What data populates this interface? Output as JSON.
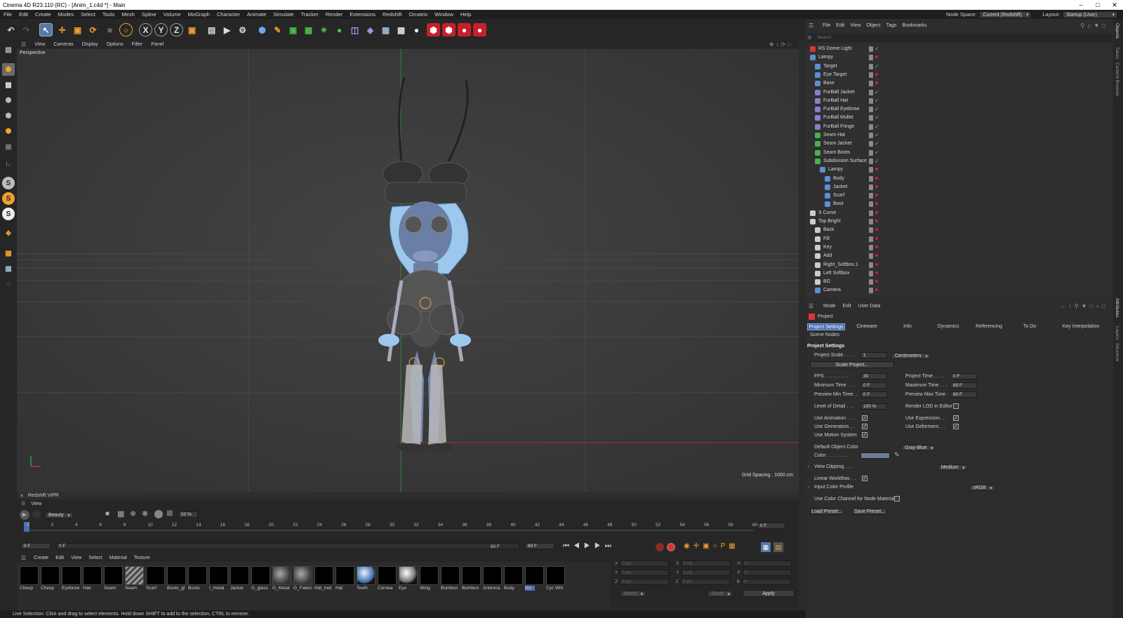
{
  "window": {
    "title": "Cinema 4D R23.110 (RC) - [Anim_1.c4d *] - Main"
  },
  "menubar": {
    "items": [
      "File",
      "Edit",
      "Create",
      "Modes",
      "Select",
      "Tools",
      "Mesh",
      "Spline",
      "Volume",
      "MoGraph",
      "Character",
      "Animate",
      "Simulate",
      "Tracker",
      "Render",
      "Extensions",
      "Redshift",
      "Ornatrix",
      "Window",
      "Help"
    ],
    "node_space_label": "Node Space:",
    "node_space_value": "Current (Redshift)",
    "layout_label": "Layout:",
    "layout_value": "Startup (User)"
  },
  "viewport": {
    "menu": [
      "View",
      "Cameras",
      "Display",
      "Options",
      "Filter",
      "Panel"
    ],
    "camera_label": "Perspective",
    "grid_spacing": "Grid Spacing : 1000 cm"
  },
  "vipr": {
    "title": "Redshift VIPR",
    "view_label": "View",
    "pass_value": "Beauty",
    "zoom_value": "50 %"
  },
  "timeline": {
    "ticks": [
      "0",
      "2",
      "4",
      "6",
      "8",
      "10",
      "12",
      "14",
      "16",
      "18",
      "20",
      "22",
      "24",
      "26",
      "28",
      "30",
      "32",
      "34",
      "36",
      "38",
      "40",
      "42",
      "44",
      "46",
      "48",
      "50",
      "52",
      "54",
      "56",
      "58",
      "60"
    ],
    "current_frame_right": "0 F",
    "start_field": "0 F",
    "start_field2": "0 F",
    "end_field": "60 F",
    "end_field2": "60 F"
  },
  "materials": {
    "menu": [
      "Create",
      "Edit",
      "View",
      "Select",
      "Material",
      "Texture"
    ],
    "items": [
      {
        "label": "Cheep",
        "swatch": "#000000"
      },
      {
        "label": "Cheep",
        "swatch": "#000000"
      },
      {
        "label": "Eyebrow",
        "swatch": "#000000"
      },
      {
        "label": "Hair",
        "swatch": "#000000"
      },
      {
        "label": "Seam",
        "swatch": "#000000"
      },
      {
        "label": "Seam",
        "swatch": "stripes"
      },
      {
        "label": "Scarf",
        "swatch": "#000000"
      },
      {
        "label": "Boots_gl",
        "swatch": "#000000"
      },
      {
        "label": "Boots",
        "swatch": "#000000"
      },
      {
        "label": "I_metal",
        "swatch": "#000000"
      },
      {
        "label": "Jacket",
        "swatch": "#000000"
      },
      {
        "label": "G_glass",
        "swatch": "#000000"
      },
      {
        "label": "G_Metal",
        "swatch": "rs"
      },
      {
        "label": "G_Fabric",
        "swatch": "rs"
      },
      {
        "label": "Hat_met",
        "swatch": "#000000"
      },
      {
        "label": "Hat",
        "swatch": "#000000"
      },
      {
        "label": "Teeth",
        "swatch": "sphere"
      },
      {
        "label": "Cornea",
        "swatch": "#000000"
      },
      {
        "label": "Eye",
        "swatch": "sphere2"
      },
      {
        "label": "Wing",
        "swatch": "#000000"
      },
      {
        "label": "Bumbun",
        "swatch": "#000000"
      },
      {
        "label": "Bumbun",
        "swatch": "#000000"
      },
      {
        "label": "Antenna",
        "swatch": "#000000"
      },
      {
        "label": "Body",
        "swatch": "#000000"
      },
      {
        "label": "BG",
        "swatch": "#000000"
      },
      {
        "label": "Cyc Whi",
        "swatch": "#000000"
      }
    ]
  },
  "coords": {
    "rows": [
      {
        "a": "X",
        "av": "0 cm",
        "b": "X",
        "bv": "0 cm",
        "c": "H",
        "cv": "0 °"
      },
      {
        "a": "Y",
        "av": "0 cm",
        "b": "Y",
        "bv": "0 cm",
        "c": "P",
        "cv": "0 °"
      },
      {
        "a": "Z",
        "av": "0 cm",
        "b": "Z",
        "bv": "0 cm",
        "c": "B",
        "cv": "0 °"
      }
    ],
    "space_value": "World",
    "mode_value": "Scale",
    "apply_label": "Apply"
  },
  "status": "Live Selection: Click and drag to select elements. Hold down SHIFT to add to the selection, CTRL to remove.",
  "objects": {
    "menu": [
      "File",
      "Edit",
      "View",
      "Object",
      "Tags",
      "Bookmarks"
    ],
    "search_placeholder": "Search",
    "rows": [
      {
        "name": "RS Dome Light",
        "indent": 0,
        "icon": "#d33",
        "check": true
      },
      {
        "name": "Lampy",
        "indent": 0,
        "icon": "#5b8fd6",
        "check": false
      },
      {
        "name": "Target",
        "indent": 1,
        "icon": "#5b8fd6",
        "check": true
      },
      {
        "name": "Eye Target",
        "indent": 1,
        "icon": "#5b8fd6",
        "check": false
      },
      {
        "name": "Base",
        "indent": 1,
        "icon": "#5b8fd6",
        "check": false
      },
      {
        "name": "FurBall Jacket",
        "indent": 1,
        "icon": "#8a7fc8",
        "check": true
      },
      {
        "name": "FurBall Hat",
        "indent": 1,
        "icon": "#8a7fc8",
        "check": true
      },
      {
        "name": "FurBall Eyebrow",
        "indent": 1,
        "icon": "#8a7fc8",
        "check": true
      },
      {
        "name": "FurBall Mullet",
        "indent": 1,
        "icon": "#8a7fc8",
        "check": true
      },
      {
        "name": "FurBall Fringe",
        "indent": 1,
        "icon": "#8a7fc8",
        "check": true
      },
      {
        "name": "Seam Hat",
        "indent": 1,
        "icon": "#4caf50",
        "check": true
      },
      {
        "name": "Seam Jacket",
        "indent": 1,
        "icon": "#4caf50",
        "check": true
      },
      {
        "name": "Seam Boots",
        "indent": 1,
        "icon": "#4caf50",
        "check": true
      },
      {
        "name": "Subdivision Surface",
        "indent": 1,
        "icon": "#4caf50",
        "check": true
      },
      {
        "name": "Lampy",
        "indent": 2,
        "icon": "#5b8fd6",
        "check": false
      },
      {
        "name": "Body",
        "indent": 3,
        "icon": "#5b8fd6",
        "check": false
      },
      {
        "name": "Jacket",
        "indent": 3,
        "icon": "#5b8fd6",
        "check": false
      },
      {
        "name": "Scarf",
        "indent": 3,
        "icon": "#5b8fd6",
        "check": false
      },
      {
        "name": "Boot",
        "indent": 3,
        "icon": "#5b8fd6",
        "check": false
      },
      {
        "name": "S Curve",
        "indent": 0,
        "icon": "#cccccc",
        "check": false
      },
      {
        "name": "Top Bright",
        "indent": 0,
        "icon": "#cccccc",
        "check": false
      },
      {
        "name": "Back",
        "indent": 1,
        "icon": "#cccccc",
        "check": false
      },
      {
        "name": "Fill",
        "indent": 1,
        "icon": "#cccccc",
        "check": false
      },
      {
        "name": "Key",
        "indent": 1,
        "icon": "#cccccc",
        "check": false
      },
      {
        "name": "Add",
        "indent": 1,
        "icon": "#cccccc",
        "check": false
      },
      {
        "name": "Right_Softbox.1",
        "indent": 1,
        "icon": "#cccccc",
        "check": false
      },
      {
        "name": "Left Softbox",
        "indent": 1,
        "icon": "#cccccc",
        "check": false
      },
      {
        "name": "BG",
        "indent": 1,
        "icon": "#cccccc",
        "check": false
      },
      {
        "name": "Camera",
        "indent": 1,
        "icon": "#5b8fd6",
        "check": false
      }
    ]
  },
  "attributes": {
    "menu": [
      "Mode",
      "Edit",
      "User Data"
    ],
    "object_name": "Project",
    "tabs": [
      "Project Settings",
      "Cineware",
      "Info",
      "Dynamics",
      "Referencing",
      "To Do",
      "Key Interpolation",
      "Scene Nodes"
    ],
    "section_title": "Project Settings",
    "project_scale_label": "Project Scale . . . .",
    "project_scale_value": "1",
    "project_scale_unit": "Centimeters",
    "scale_project_button": "Scale Project...",
    "fps_label": "FPS . . . . . . . . .",
    "fps_value": "30",
    "project_time_label": "Project Time . . . .",
    "project_time_value": "0 F",
    "min_time_label": "Minimum Time . . .",
    "min_time_value": "0 F",
    "max_time_label": "Maximum Time . . .",
    "max_time_value": "60 F",
    "prev_min_label": "Preview Min Time. .",
    "prev_min_value": "0 F",
    "prev_max_label": "Preview Max Time .",
    "prev_max_value": "60 F",
    "lod_label": "Level of Detail . . .",
    "lod_value": "100 %",
    "render_lod_label": "Render LOD in Editor",
    "use_animation_label": "Use Animation . . .",
    "use_expression_label": "Use Expression. . .",
    "use_generators_label": "Use Generators . .",
    "use_deformers_label": "Use Deformers. . .",
    "use_motion_label": "Use Motion System",
    "default_color_label": "Default Object Color",
    "default_color_value": "Gray-Blue",
    "color_label": "Color . . . . . . . .",
    "view_clipping_label": "View Clipping . . .",
    "view_clipping_value": "Medium",
    "linear_workflow_label": "Linear Workflow. . .",
    "input_color_label": "Input Color Profile",
    "input_color_value": "sRGB",
    "use_color_channel_label": "Use Color Channel for Node Material",
    "load_preset": "Load Preset...",
    "save_preset": "Save Preset..."
  },
  "side_tabs": [
    "Objects",
    "Takes",
    "Content Browser",
    "Attributes",
    "Layers",
    "Structure"
  ]
}
